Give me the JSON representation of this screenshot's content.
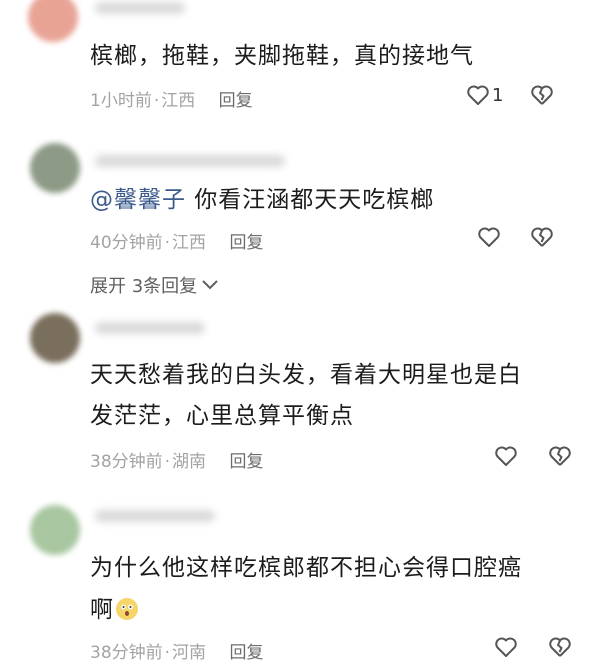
{
  "comments": [
    {
      "text": "槟榔，拖鞋，夹脚拖鞋，真的接地气",
      "time": "1小时前",
      "location": "江西",
      "reply_label": "回复",
      "likes": "1",
      "avatar_color": "#e8a395"
    },
    {
      "mention": "@馨馨子",
      "text": " 你看汪涵都天天吃槟榔",
      "time": "40分钟前",
      "location": "江西",
      "reply_label": "回复",
      "expand_label": "展开 3条回复",
      "avatar_color": "#8d9a86"
    },
    {
      "text_line1": "天天愁着我的白头发，看着大明星也是白",
      "text_line2": "发茫茫，心里总算平衡点",
      "time": "38分钟前",
      "location": "湖南",
      "reply_label": "回复",
      "avatar_color": "#7a6e5c"
    },
    {
      "text_line1": "为什么他这样吃槟郎都不担心会得口腔癌",
      "text_line2": "啊",
      "emoji": "astonished-face-emoji",
      "time": "38分钟前",
      "location": "河南",
      "reply_label": "回复",
      "avatar_color": "#a8c6a0"
    }
  ],
  "meta_separator": "·"
}
